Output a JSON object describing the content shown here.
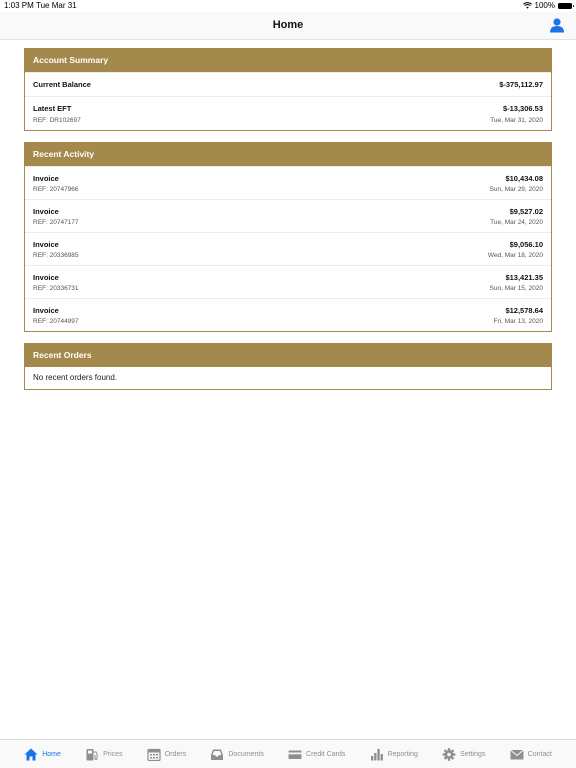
{
  "status_bar": {
    "time": "1:03 PM",
    "date": "Tue Mar 31",
    "battery": "100%"
  },
  "nav": {
    "title": "Home"
  },
  "account_summary": {
    "title": "Account Summary",
    "balance_label": "Current Balance",
    "balance_value": "$-375,112.97",
    "eft_label": "Latest EFT",
    "eft_value": "$-13,306.53",
    "eft_ref": "REF: DR102697",
    "eft_date": "Tue, Mar 31, 2020"
  },
  "recent_activity": {
    "title": "Recent Activity",
    "items": [
      {
        "label": "Invoice",
        "amount": "$10,434.08",
        "ref": "REF: 20747966",
        "date": "Sun, Mar 29, 2020"
      },
      {
        "label": "Invoice",
        "amount": "$9,527.02",
        "ref": "REF: 20747177",
        "date": "Tue, Mar 24, 2020"
      },
      {
        "label": "Invoice",
        "amount": "$9,056.10",
        "ref": "REF: 20336985",
        "date": "Wed, Mar 18, 2020"
      },
      {
        "label": "Invoice",
        "amount": "$13,421.35",
        "ref": "REF: 20336731",
        "date": "Sun, Mar 15, 2020"
      },
      {
        "label": "Invoice",
        "amount": "$12,578.64",
        "ref": "REF: 20744997",
        "date": "Fri, Mar 13, 2020"
      }
    ]
  },
  "recent_orders": {
    "title": "Recent Orders",
    "empty_text": "No recent orders found."
  },
  "tabs": [
    {
      "label": "Home",
      "icon": "home-icon",
      "active": true
    },
    {
      "label": "Prices",
      "icon": "fuel-pump-icon",
      "active": false
    },
    {
      "label": "Orders",
      "icon": "calendar-icon",
      "active": false
    },
    {
      "label": "Documents",
      "icon": "inbox-icon",
      "active": false
    },
    {
      "label": "Credit Cards",
      "icon": "credit-card-icon",
      "active": false
    },
    {
      "label": "Reporting",
      "icon": "bar-chart-icon",
      "active": false
    },
    {
      "label": "Settings",
      "icon": "gear-icon",
      "active": false
    },
    {
      "label": "Contact",
      "icon": "envelope-icon",
      "active": false
    }
  ],
  "colors": {
    "header_gold": "#a3894c",
    "tab_active": "#1a73e8",
    "tab_inactive": "#8e8e93"
  }
}
